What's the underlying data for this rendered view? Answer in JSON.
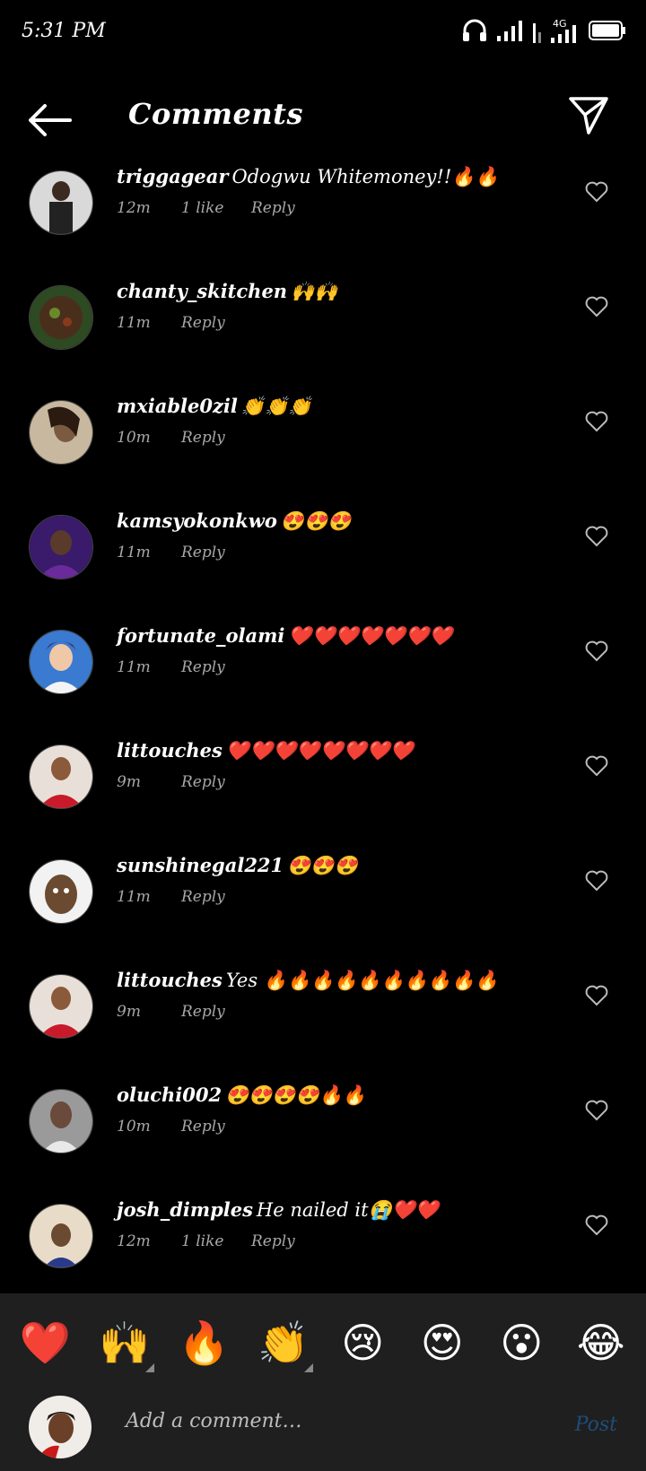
{
  "status": {
    "time": "5:31 PM",
    "network": "4G"
  },
  "header": {
    "title": "Comments"
  },
  "comments": [
    {
      "user": "triggagear",
      "text": "Odogwu Whitemoney!!🔥🔥",
      "time": "12m",
      "likes": "1 like",
      "reply": "Reply"
    },
    {
      "user": "chanty_skitchen",
      "text": "🙌🙌",
      "time": "11m",
      "likes": "",
      "reply": "Reply"
    },
    {
      "user": "mxiable0zil",
      "text": "👏👏👏",
      "time": "10m",
      "likes": "",
      "reply": "Reply"
    },
    {
      "user": "kamsyokonkwo",
      "text": "😍😍😍",
      "time": "11m",
      "likes": "",
      "reply": "Reply"
    },
    {
      "user": "fortunate_olami",
      "text": "❤️❤️❤️❤️❤️❤️❤️",
      "time": "11m",
      "likes": "",
      "reply": "Reply"
    },
    {
      "user": "littouches",
      "text": "❤️❤️❤️❤️❤️❤️❤️❤️",
      "time": "9m",
      "likes": "",
      "reply": "Reply"
    },
    {
      "user": "sunshinegal221",
      "text": "😍😍😍",
      "time": "11m",
      "likes": "",
      "reply": "Reply"
    },
    {
      "user": "littouches",
      "text": "Yes 🔥🔥🔥🔥🔥🔥🔥🔥🔥🔥",
      "time": "9m",
      "likes": "",
      "reply": "Reply"
    },
    {
      "user": "oluchi002",
      "text": "😍😍😍😍🔥🔥",
      "time": "10m",
      "likes": "",
      "reply": "Reply"
    },
    {
      "user": "josh_dimples",
      "text": "He nailed it😭❤️❤️",
      "time": "12m",
      "likes": "1 like",
      "reply": "Reply"
    }
  ],
  "emoji_bar": [
    "❤️",
    "🙌",
    "🔥",
    "👏",
    "😢",
    "😍",
    "😮",
    "😂"
  ],
  "composer": {
    "placeholder": "Add a comment…",
    "post_label": "Post"
  },
  "colors": {
    "background": "#000000",
    "bar": "#1f1f1f",
    "post": "#1f4d7a",
    "meta": "#a8a8a8"
  }
}
